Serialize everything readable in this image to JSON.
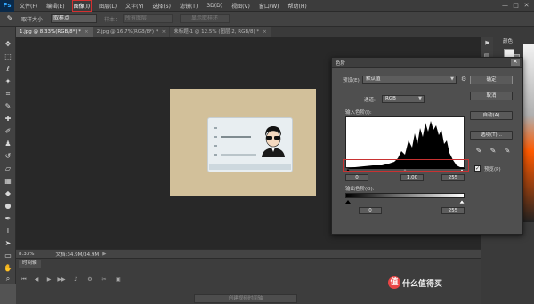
{
  "app": {
    "logo": "Ps"
  },
  "menubar": {
    "items": [
      "文件(F)",
      "编辑(E)",
      "图像(I)",
      "图层(L)",
      "文字(Y)",
      "选择(S)",
      "滤镜(T)",
      "3D(D)",
      "视图(V)",
      "窗口(W)",
      "帮助(H)"
    ],
    "active_index": 2,
    "window_controls": [
      "—",
      "□",
      "✕"
    ]
  },
  "options": {
    "sample_size_label": "取样大小：",
    "sample_size_value": "取样点",
    "sample_label": "样本：",
    "sample_value": "所有图层",
    "show_ring_label": "显示取样环"
  },
  "tabs": [
    {
      "label": "1.jpg @ 8.33%(RGB/8*) *",
      "active": true
    },
    {
      "label": "2.jpg @ 16.7%(RGB/8*) *",
      "active": false
    },
    {
      "label": "未标题-1 @ 12.5% (图层 2, RGB/8) *",
      "active": false
    }
  ],
  "tab_close_glyph": "×",
  "status": {
    "zoom": "8.33%",
    "doc": "文档:34.9M/34.9M",
    "arrow": "▶"
  },
  "timeline": {
    "tab_label": "时间轴",
    "create_video_label": "创建视频时间轴"
  },
  "right_panel": {
    "color_tab": "颜色"
  },
  "levels": {
    "title": "色阶",
    "close_glyph": "✕",
    "preset_label": "预设(E):",
    "preset_value": "默认值",
    "channel_label": "通道:",
    "channel_value": "RGB",
    "input_levels_label": "输入色阶(I):",
    "input_values": [
      "0",
      "1.00",
      "255"
    ],
    "output_levels_label": "输出色阶(O):",
    "output_values": [
      "0",
      "255"
    ],
    "buttons": {
      "ok": "确定",
      "cancel": "取消",
      "auto": "自动(A)",
      "options": "选项(T)..."
    },
    "preview_label": "预览(P)",
    "preview_checked": true,
    "check_glyph": "✓",
    "histogram_color": "#000000",
    "highlight_color": "#c83232"
  },
  "watermark": {
    "badge": "值",
    "text": "什么值得买"
  }
}
